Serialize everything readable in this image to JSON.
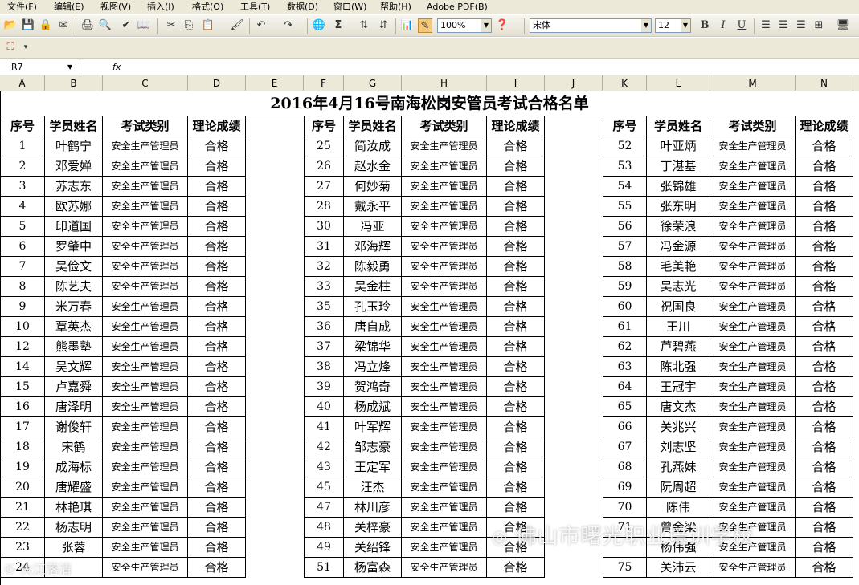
{
  "menu": [
    "文件(F)",
    "编辑(E)",
    "视图(V)",
    "插入(I)",
    "格式(O)",
    "工具(T)",
    "数据(D)",
    "窗口(W)",
    "帮助(H)",
    "Adobe PDF(B)"
  ],
  "toolbar": {
    "zoom": "100%",
    "font": "宋体",
    "font_size": "12",
    "bold": "B",
    "italic": "I",
    "underline": "U",
    "sigma": "Σ"
  },
  "formula": {
    "name_box": "R7",
    "fx": "fx"
  },
  "columns": [
    "A",
    "B",
    "C",
    "D",
    "E",
    "F",
    "G",
    "H",
    "I",
    "J",
    "K",
    "L",
    "M",
    "N"
  ],
  "sheet": {
    "title": "2016年4月16号南海松岗安管员考试合格名单",
    "headers": [
      "序号",
      "学员姓名",
      "考试类别",
      "理论成绩"
    ],
    "groups": [
      {
        "rows": [
          [
            "1",
            "叶鹤宁",
            "安全生产管理员",
            "合格"
          ],
          [
            "2",
            "邓爱婵",
            "安全生产管理员",
            "合格"
          ],
          [
            "3",
            "苏志东",
            "安全生产管理员",
            "合格"
          ],
          [
            "4",
            "欧苏娜",
            "安全生产管理员",
            "合格"
          ],
          [
            "5",
            "印道国",
            "安全生产管理员",
            "合格"
          ],
          [
            "6",
            "罗肇中",
            "安全生产管理员",
            "合格"
          ],
          [
            "7",
            "吴俭文",
            "安全生产管理员",
            "合格"
          ],
          [
            "8",
            "陈艺夫",
            "安全生产管理员",
            "合格"
          ],
          [
            "9",
            "米万春",
            "安全生产管理员",
            "合格"
          ],
          [
            "10",
            "覃英杰",
            "安全生产管理员",
            "合格"
          ],
          [
            "12",
            "熊墨塾",
            "安全生产管理员",
            "合格"
          ],
          [
            "14",
            "吴文辉",
            "安全生产管理员",
            "合格"
          ],
          [
            "15",
            "卢嘉舜",
            "安全生产管理员",
            "合格"
          ],
          [
            "16",
            "唐泽明",
            "安全生产管理员",
            "合格"
          ],
          [
            "17",
            "谢俊轩",
            "安全生产管理员",
            "合格"
          ],
          [
            "18",
            "宋鹤",
            "安全生产管理员",
            "合格"
          ],
          [
            "19",
            "成海标",
            "安全生产管理员",
            "合格"
          ],
          [
            "20",
            "唐耀盛",
            "安全生产管理员",
            "合格"
          ],
          [
            "21",
            "林艳琪",
            "安全生产管理员",
            "合格"
          ],
          [
            "22",
            "杨志明",
            "安全生产管理员",
            "合格"
          ],
          [
            "23",
            "张蓉",
            "安全生产管理员",
            "合格"
          ],
          [
            "24",
            "",
            "安全生产管理员",
            "合格"
          ]
        ]
      },
      {
        "rows": [
          [
            "25",
            "简汝成",
            "安全生产管理员",
            "合格"
          ],
          [
            "26",
            "赵水金",
            "安全生产管理员",
            "合格"
          ],
          [
            "27",
            "何妙菊",
            "安全生产管理员",
            "合格"
          ],
          [
            "28",
            "戴永平",
            "安全生产管理员",
            "合格"
          ],
          [
            "30",
            "冯亚",
            "安全生产管理员",
            "合格"
          ],
          [
            "31",
            "邓海辉",
            "安全生产管理员",
            "合格"
          ],
          [
            "32",
            "陈毅勇",
            "安全生产管理员",
            "合格"
          ],
          [
            "33",
            "吴金柱",
            "安全生产管理员",
            "合格"
          ],
          [
            "35",
            "孔玉玲",
            "安全生产管理员",
            "合格"
          ],
          [
            "36",
            "唐自成",
            "安全生产管理员",
            "合格"
          ],
          [
            "37",
            "梁锦华",
            "安全生产管理员",
            "合格"
          ],
          [
            "38",
            "冯立烽",
            "安全生产管理员",
            "合格"
          ],
          [
            "39",
            "贺鸿奇",
            "安全生产管理员",
            "合格"
          ],
          [
            "40",
            "杨成斌",
            "安全生产管理员",
            "合格"
          ],
          [
            "41",
            "叶军辉",
            "安全生产管理员",
            "合格"
          ],
          [
            "42",
            "邹志豪",
            "安全生产管理员",
            "合格"
          ],
          [
            "43",
            "王定军",
            "安全生产管理员",
            "合格"
          ],
          [
            "45",
            "汪杰",
            "安全生产管理员",
            "合格"
          ],
          [
            "47",
            "林川彦",
            "安全生产管理员",
            "合格"
          ],
          [
            "48",
            "关梓豪",
            "安全生产管理员",
            "合格"
          ],
          [
            "49",
            "关绍锋",
            "安全生产管理员",
            "合格"
          ],
          [
            "51",
            "杨富森",
            "安全生产管理员",
            "合格"
          ]
        ]
      },
      {
        "rows": [
          [
            "52",
            "叶亚炳",
            "安全生产管理员",
            "合格"
          ],
          [
            "53",
            "丁湛基",
            "安全生产管理员",
            "合格"
          ],
          [
            "54",
            "张锦雄",
            "安全生产管理员",
            "合格"
          ],
          [
            "55",
            "张东明",
            "安全生产管理员",
            "合格"
          ],
          [
            "56",
            "徐荣浪",
            "安全生产管理员",
            "合格"
          ],
          [
            "57",
            "冯金源",
            "安全生产管理员",
            "合格"
          ],
          [
            "58",
            "毛美艳",
            "安全生产管理员",
            "合格"
          ],
          [
            "59",
            "吴志光",
            "安全生产管理员",
            "合格"
          ],
          [
            "60",
            "祝国良",
            "安全生产管理员",
            "合格"
          ],
          [
            "61",
            "王川",
            "安全生产管理员",
            "合格"
          ],
          [
            "62",
            "芦碧燕",
            "安全生产管理员",
            "合格"
          ],
          [
            "63",
            "陈北强",
            "安全生产管理员",
            "合格"
          ],
          [
            "64",
            "王冠宇",
            "安全生产管理员",
            "合格"
          ],
          [
            "65",
            "唐文杰",
            "安全生产管理员",
            "合格"
          ],
          [
            "66",
            "关兆兴",
            "安全生产管理员",
            "合格"
          ],
          [
            "67",
            "刘志坚",
            "安全生产管理员",
            "合格"
          ],
          [
            "68",
            "孔燕妹",
            "安全生产管理员",
            "合格"
          ],
          [
            "69",
            "阮周超",
            "安全生产管理员",
            "合格"
          ],
          [
            "70",
            "陈伟",
            "安全生产管理员",
            "合格"
          ],
          [
            "71",
            "曾金梁",
            "安全生产管理员",
            "合格"
          ],
          [
            "",
            "杨伟强",
            "安全生产管理员",
            "合格"
          ],
          [
            "75",
            "关沛云",
            "安全生产管理员",
            "合格"
          ]
        ]
      }
    ]
  },
  "watermark": {
    "right": "佛山市曙光职业培训学校",
    "left": "大江落清"
  }
}
